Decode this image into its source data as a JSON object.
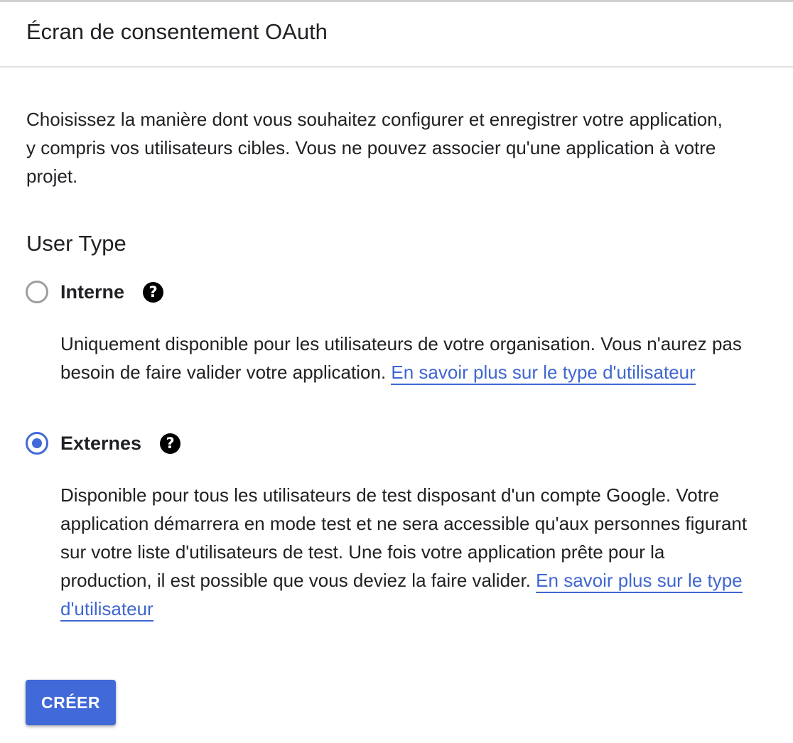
{
  "header": {
    "title": "Écran de consentement OAuth"
  },
  "intro": {
    "text": "Choisissez la manière dont vous souhaitez configurer et enregistrer votre application, y compris vos utilisateurs cibles. Vous ne pouvez associer qu'une application à votre projet."
  },
  "user_type": {
    "title": "User Type",
    "selected": "external",
    "options": [
      {
        "id": "internal",
        "label": "Interne",
        "help_icon": "help-circle-icon",
        "checked": false,
        "description": "Uniquement disponible pour les utilisateurs de votre organisation. Vous n'aurez pas besoin de faire valider votre application.",
        "link_text": "En savoir plus sur le type d'utilisateur"
      },
      {
        "id": "external",
        "label": "Externes",
        "help_icon": "help-circle-icon",
        "checked": true,
        "description": "Disponible pour tous les utilisateurs de test disposant d'un compte Google. Votre application démarrera en mode test et ne sera accessible qu'aux personnes figurant sur votre liste d'utilisateurs de test. Une fois votre application prête pour la production, il est possible que vous deviez la faire valider.",
        "link_text": "En savoir plus sur le type d'utilisateur"
      }
    ]
  },
  "actions": {
    "create_label": "CRÉER"
  },
  "colors": {
    "accent": "#4169d8",
    "link": "#3f66d1",
    "text": "#202124",
    "radio_unchecked": "#9e9e9e"
  }
}
